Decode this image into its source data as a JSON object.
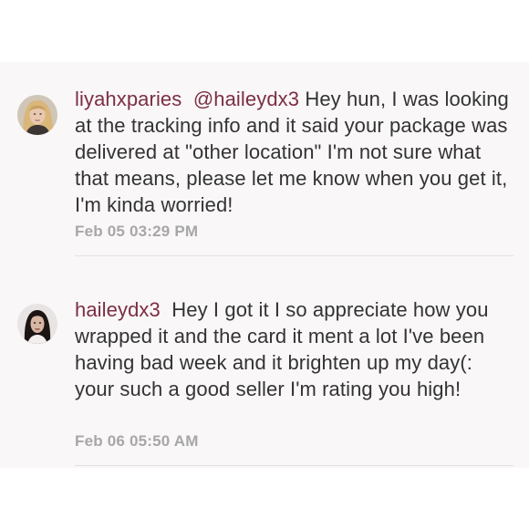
{
  "comments": [
    {
      "username": "liyahxparies",
      "mention": "@haileydx3",
      "text": "Hey hun, I was looking at the tracking info and it said your package was delivered at \"other location\" I'm not sure what that means, please let me know when you get it, I'm kinda worried!",
      "timestamp": "Feb 05 03:29 PM",
      "avatar_colors": {
        "hair": "#d9b77a",
        "skin": "#e8c9b0",
        "bg": "#cfc6b8"
      }
    },
    {
      "username": "haileydx3",
      "mention": "",
      "text": "Hey I got it I so appreciate how you wrapped it and the card it ment a lot I've been having bad week and it brighten up my day(: your such a good seller I'm rating you high!",
      "timestamp": "Feb 06 05:50 AM",
      "avatar_colors": {
        "hair": "#1c1514",
        "skin": "#d8b6a4",
        "bg": "#e9e4e4"
      }
    }
  ],
  "colors": {
    "username": "#7b2f44",
    "text": "#333333",
    "timestamp": "#a7a7a7",
    "panel_bg": "#f9f7f7",
    "divider": "#e3e0e0"
  }
}
